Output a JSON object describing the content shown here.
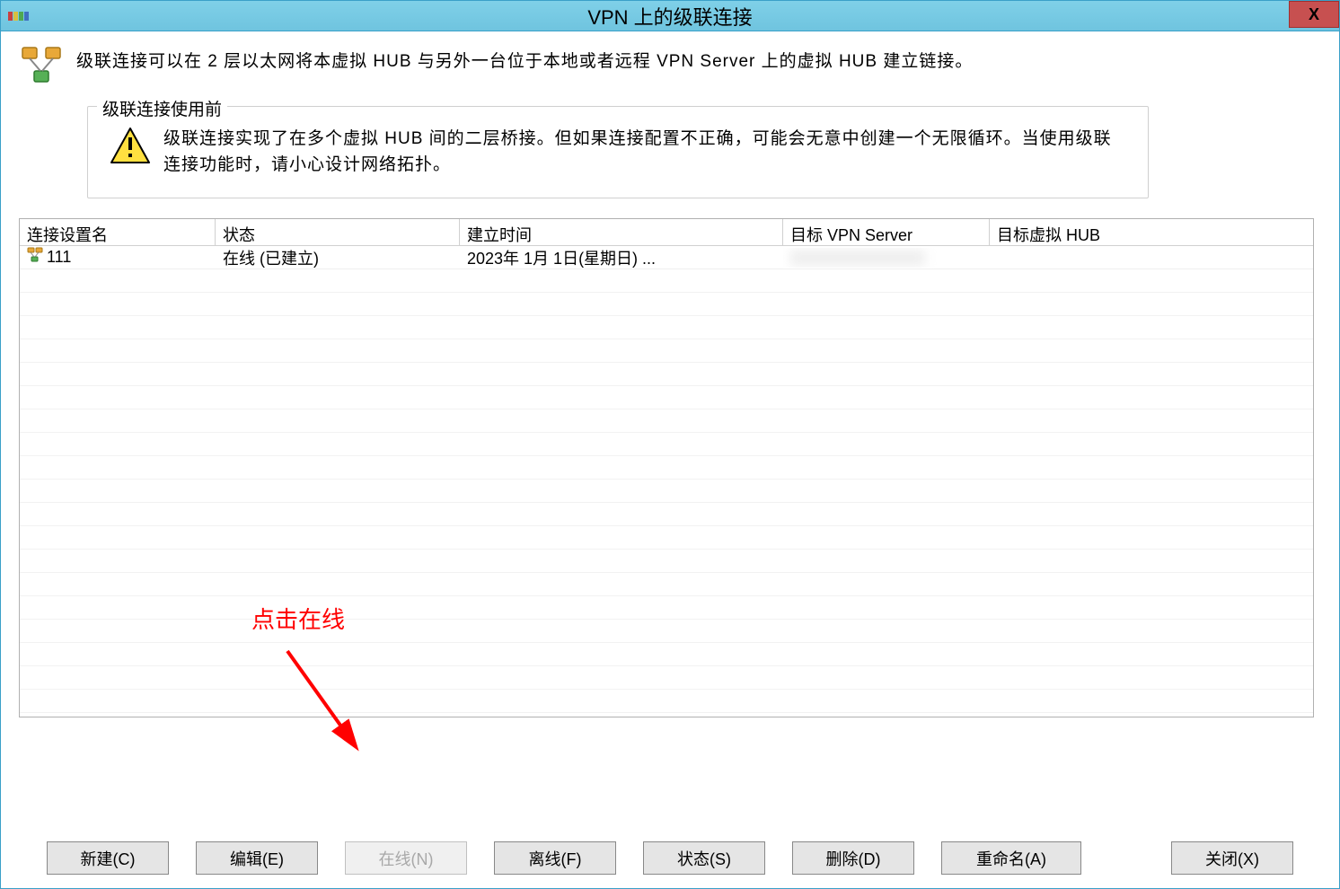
{
  "window": {
    "title": "VPN 上的级联连接",
    "close_glyph": "X"
  },
  "header": {
    "description": "级联连接可以在 2 层以太网将本虚拟 HUB 与另外一台位于本地或者远程 VPN Server 上的虚拟 HUB 建立链接。"
  },
  "groupbox": {
    "title": "级联连接使用前",
    "warning_text": "级联连接实现了在多个虚拟 HUB 间的二层桥接。但如果连接配置不正确，可能会无意中创建一个无限循环。当使用级联连接功能时，请小心设计网络拓扑。"
  },
  "table": {
    "columns": [
      "连接设置名",
      "状态",
      "建立时间",
      "目标 VPN Server",
      "目标虚拟 HUB"
    ],
    "rows": [
      {
        "name": "111",
        "status": "在线 (已建立)",
        "created": "2023年 1月 1日(星期日)  ...",
        "target_server": "",
        "target_hub": ""
      }
    ]
  },
  "annotation": {
    "label": "点击在线"
  },
  "buttons": {
    "new": "新建(C)",
    "edit": "编辑(E)",
    "online": "在线(N)",
    "offline": "离线(F)",
    "status": "状态(S)",
    "delete": "删除(D)",
    "rename": "重命名(A)",
    "close": "关闭(X)"
  }
}
